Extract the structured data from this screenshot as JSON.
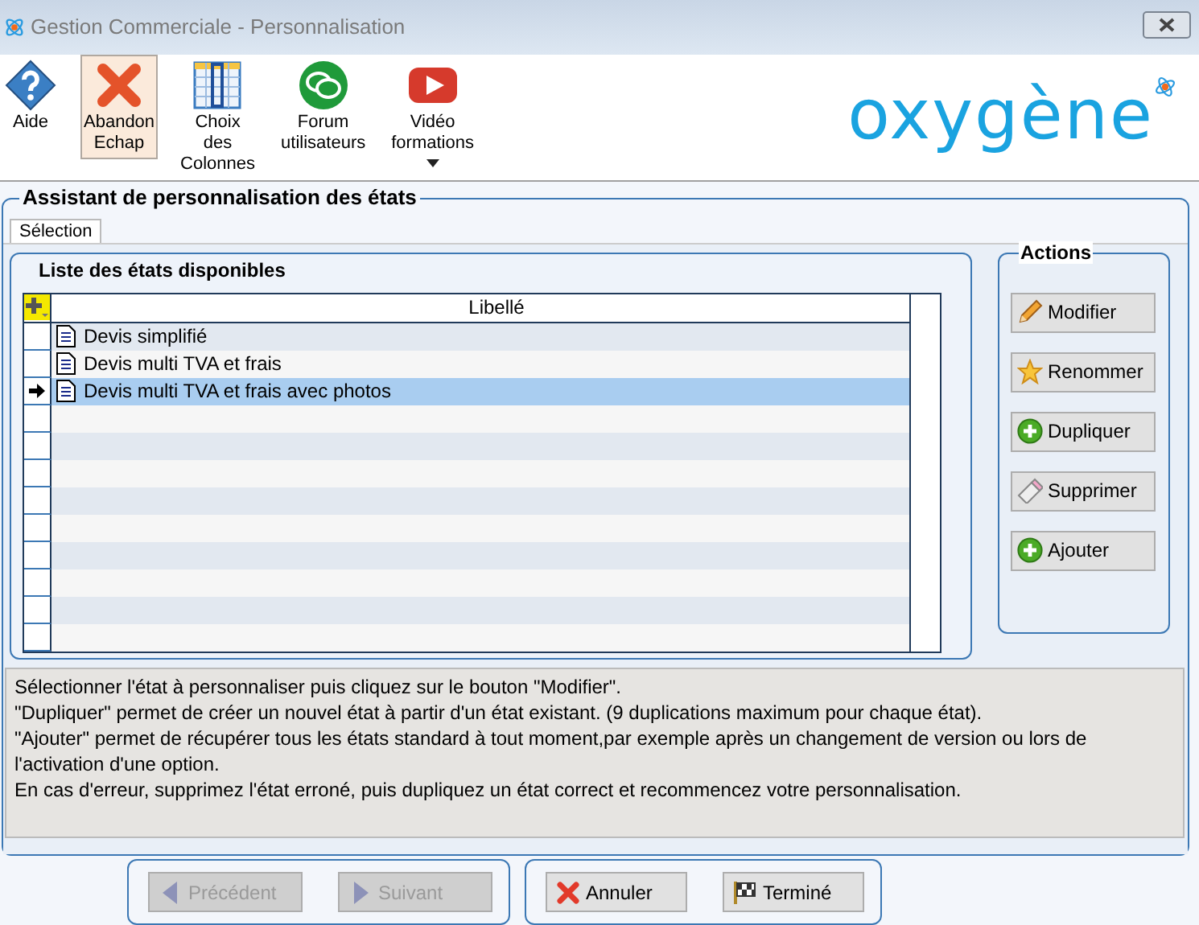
{
  "window": {
    "title": "Gestion Commerciale - Personnalisation"
  },
  "toolbar": [
    {
      "label": "Aide",
      "kind": "help",
      "highlighted": false,
      "dropdown": false
    },
    {
      "label": "Abandon\nEchap",
      "kind": "cross",
      "highlighted": true,
      "dropdown": false
    },
    {
      "label": "Choix\ndes\nColonnes",
      "kind": "columns",
      "highlighted": false,
      "dropdown": false
    },
    {
      "label": "Forum\nutilisateurs",
      "kind": "chat",
      "highlighted": false,
      "dropdown": false
    },
    {
      "label": "Vidéo\nformations",
      "kind": "video",
      "highlighted": false,
      "dropdown": true
    }
  ],
  "logo": "oxygène",
  "wizard": {
    "title": "Assistant de personnalisation des états",
    "tabs": [
      {
        "label": "Sélection",
        "selected": true
      }
    ],
    "list": {
      "title": "Liste des états disponibles",
      "column": "Libellé",
      "rows": [
        {
          "label": "Devis simplifié",
          "selected": false
        },
        {
          "label": "Devis multi TVA et frais",
          "selected": false
        },
        {
          "label": "Devis multi TVA et frais avec photos",
          "selected": true
        }
      ]
    },
    "actions": {
      "title": "Actions",
      "buttons": [
        {
          "label": "Modifier",
          "kind": "pencil"
        },
        {
          "label": "Renommer",
          "kind": "star"
        },
        {
          "label": "Dupliquer",
          "kind": "plus"
        },
        {
          "label": "Supprimer",
          "kind": "eraser"
        },
        {
          "label": "Ajouter",
          "kind": "plus"
        }
      ]
    },
    "help": [
      "Sélectionner l'état à personnaliser puis cliquez sur le bouton \"Modifier\".",
      "\"Dupliquer\" permet de créer un nouvel état à partir d'un état existant. (9 duplications maximum pour chaque état).",
      "\"Ajouter\" permet de récupérer tous les états standard à tout moment,par exemple après un changement de version ou lors de l'activation d'une option.",
      "En cas d'erreur, supprimez l'état erroné, puis dupliquez un état correct et recommencez votre personnalisation."
    ]
  },
  "nav": [
    [
      {
        "label": "Précédent",
        "kind": "back",
        "disabled": true
      },
      {
        "label": "Suivant",
        "kind": "next",
        "disabled": true
      }
    ],
    [
      {
        "label": "Annuler",
        "kind": "cross",
        "disabled": false
      },
      {
        "label": "Terminé",
        "kind": "flag",
        "disabled": false
      }
    ]
  ]
}
